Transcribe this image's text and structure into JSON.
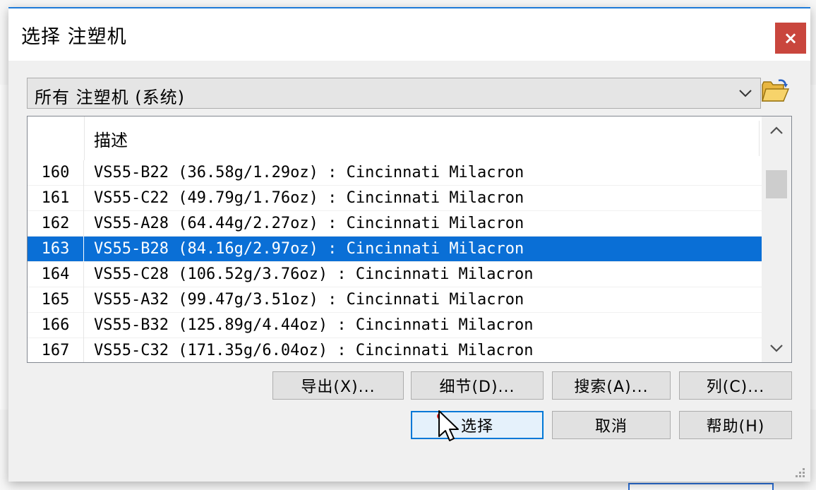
{
  "dialog": {
    "title": "选择 注塑机",
    "close_label": "×"
  },
  "combo": {
    "selected": "所有 注塑机 (系统)"
  },
  "list": {
    "header_desc": "描述",
    "rows": [
      {
        "num": "160",
        "desc": "VS55-B22 (36.58g/1.29oz) : Cincinnati Milacron"
      },
      {
        "num": "161",
        "desc": "VS55-C22 (49.79g/1.76oz) : Cincinnati Milacron"
      },
      {
        "num": "162",
        "desc": "VS55-A28 (64.44g/2.27oz) : Cincinnati Milacron"
      },
      {
        "num": "163",
        "desc": "VS55-B28 (84.16g/2.97oz) : Cincinnati Milacron"
      },
      {
        "num": "164",
        "desc": "VS55-C28 (106.52g/3.76oz) : Cincinnati Milacron"
      },
      {
        "num": "165",
        "desc": "VS55-A32 (99.47g/3.51oz) : Cincinnati Milacron"
      },
      {
        "num": "166",
        "desc": "VS55-B32 (125.89g/4.44oz) : Cincinnati Milacron"
      },
      {
        "num": "167",
        "desc": "VS55-C32 (171.35g/6.04oz) : Cincinnati Milacron"
      }
    ],
    "selected_index": 3
  },
  "buttons": {
    "export": "导出(X)...",
    "details": "细节(D)...",
    "search": "搜索(A)...",
    "columns": "列(C)...",
    "select": "选择",
    "cancel": "取消",
    "help": "帮助(H)"
  },
  "colors": {
    "selection": "#0a6fd6",
    "close_bg": "#c9463d",
    "title_border": "#1e7ad8"
  }
}
